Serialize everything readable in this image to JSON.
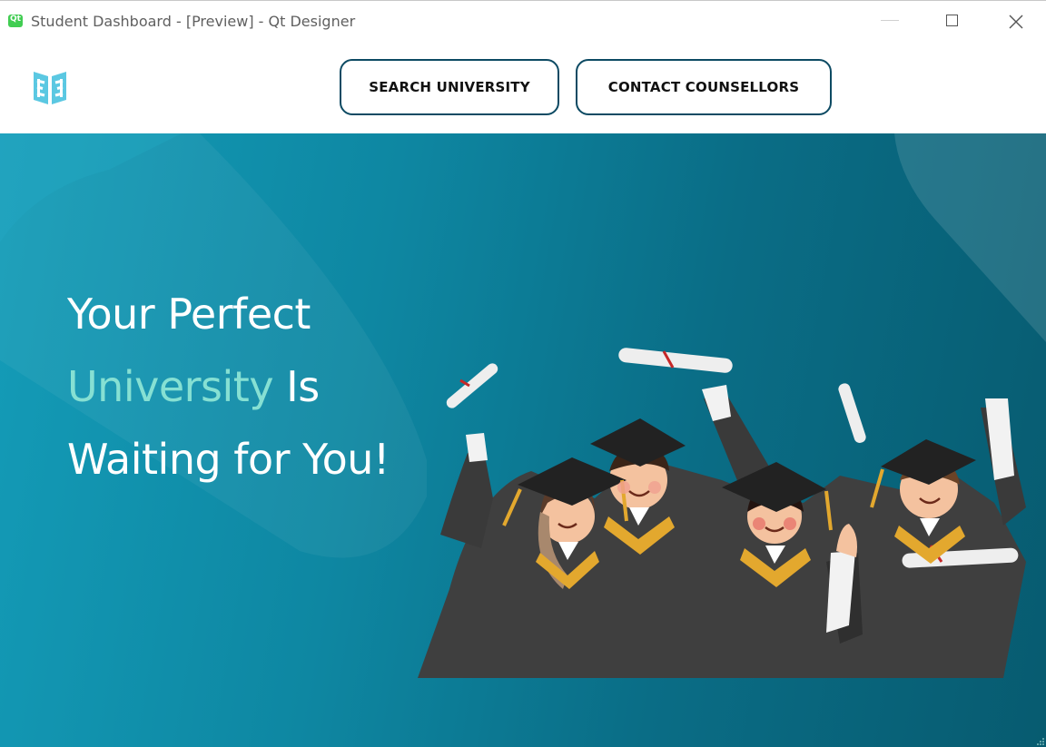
{
  "window": {
    "title": "Student Dashboard - [Preview] - Qt Designer",
    "app_badge": "Qt"
  },
  "header": {
    "logo_icon": "open-book-logo-icon",
    "nav": [
      {
        "label": "SEARCH UNIVERSITY"
      },
      {
        "label": "CONTACT COUNSELLORS"
      }
    ]
  },
  "hero": {
    "line1": "Your Perfect",
    "line2_accent": "University",
    "line2_rest": " Is",
    "line3": "Waiting for You!",
    "illustration": "graduates-celebrating-illustration"
  },
  "colors": {
    "accent_text": "#86e0d3",
    "button_border": "#0d4a63",
    "hero_start": "#149cb8",
    "hero_end": "#075b70",
    "logo": "#5bc8e2"
  }
}
